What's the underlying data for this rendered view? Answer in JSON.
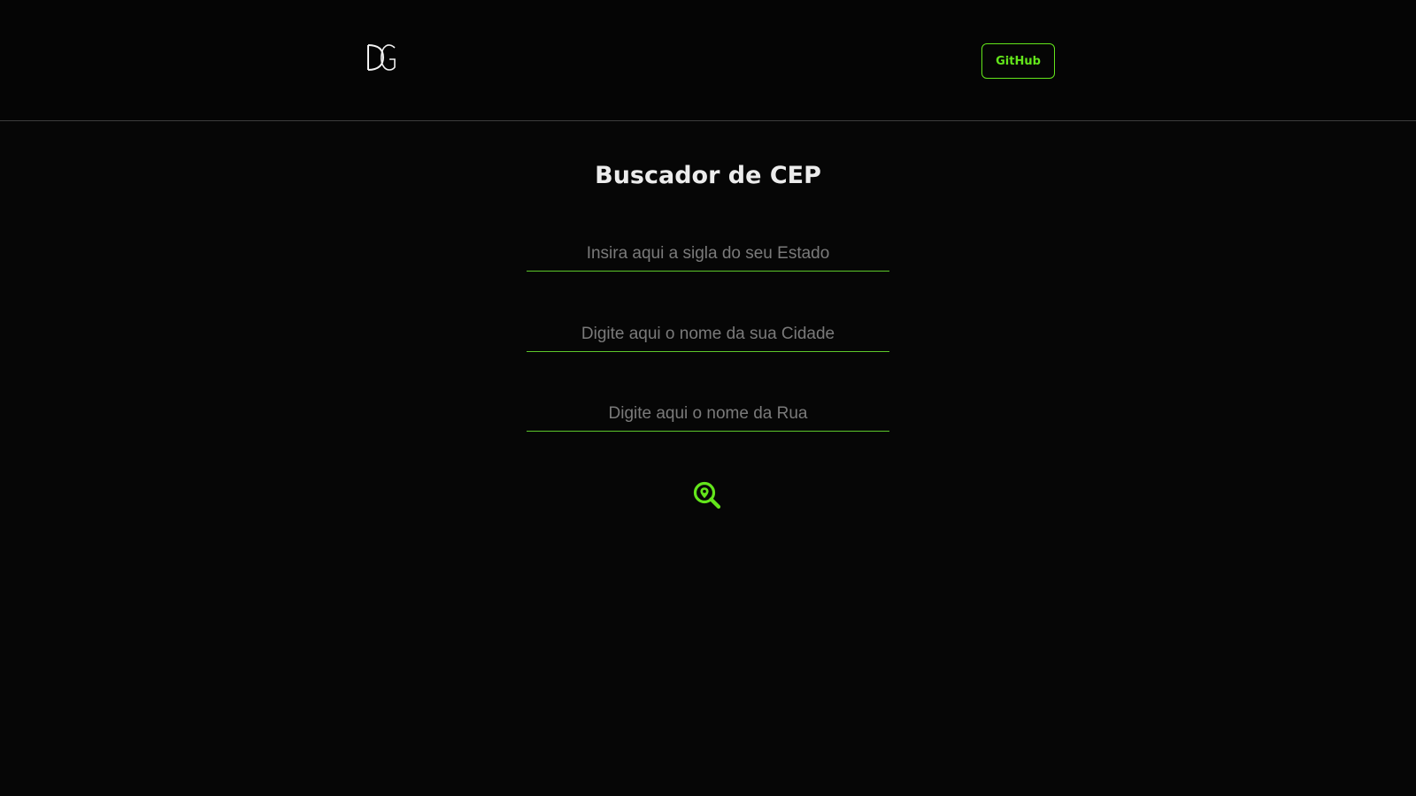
{
  "header": {
    "logo_icon": "dg-monogram-logo",
    "github_label": "GitHub"
  },
  "main": {
    "title": "Buscador de CEP",
    "fields": {
      "estado_placeholder": "Insira aqui a sigla do seu Estado",
      "cidade_placeholder": "Digite aqui o nome da sua Cidade",
      "rua_placeholder": "Digite aqui o nome da Rua"
    },
    "search_icon": "search-location-icon"
  },
  "colors": {
    "accent": "#63e51b",
    "background": "#060606",
    "title": "#ececec",
    "placeholder": "#7a7a7a"
  }
}
